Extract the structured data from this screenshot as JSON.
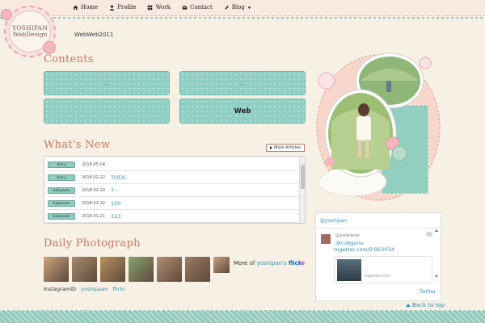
{
  "logo": {
    "line1": "YOSHIPAN",
    "line2": "WebDesign"
  },
  "nav": [
    {
      "label": "Home",
      "icon": "home-icon"
    },
    {
      "label": "Profile",
      "icon": "user-icon"
    },
    {
      "label": "Work",
      "icon": "grid-icon"
    },
    {
      "label": "Contact",
      "icon": "mail-icon"
    },
    {
      "label": "Blog",
      "icon": "pencil-icon"
    }
  ],
  "site_desc": "WebWeb2011",
  "contents": {
    "heading": "Contents",
    "cards": [
      "...",
      "...",
      "",
      "Web"
    ]
  },
  "whats_new": {
    "heading": "What's New",
    "more_label": "More Articles",
    "items": [
      {
        "tag": "diary",
        "date": "2018-05-04",
        "title": ""
      },
      {
        "tag": "diary",
        "date": "2018-02-22",
        "title": "TOEIC"
      },
      {
        "tag": "babyeats",
        "date": "2018-02-20",
        "title": "7···"
      },
      {
        "tag": "babyeats",
        "date": "2018-02-12",
        "title": "100"
      },
      {
        "tag": "babyeats",
        "date": "2018-01-21",
        "title": "123"
      }
    ]
  },
  "daily": {
    "heading": "Daily Photograph",
    "more_prefix": "More of",
    "more_user": "yoshipan's",
    "flickr_a": "flick",
    "flickr_b": "r",
    "insta_label": "InstagramID",
    "insta_user": "yoshipaan",
    "insta_flickr": "flickr",
    "photo_colors": [
      "#caa57a",
      "#a98b6e",
      "#b8915e",
      "#8aa36e",
      "#b38d73",
      "#9b7b62",
      "#c7a27f"
    ]
  },
  "twitter": {
    "header_user": "@yoshipan",
    "tweet_handle": "@yoshipan",
    "tweet_text": ".@cu6gane",
    "tweet_link": "togetter.com/li/963034",
    "card_title": "..",
    "card_url": "togetter.com",
    "footer": "Twitter"
  },
  "back_to_top": "Back to top"
}
